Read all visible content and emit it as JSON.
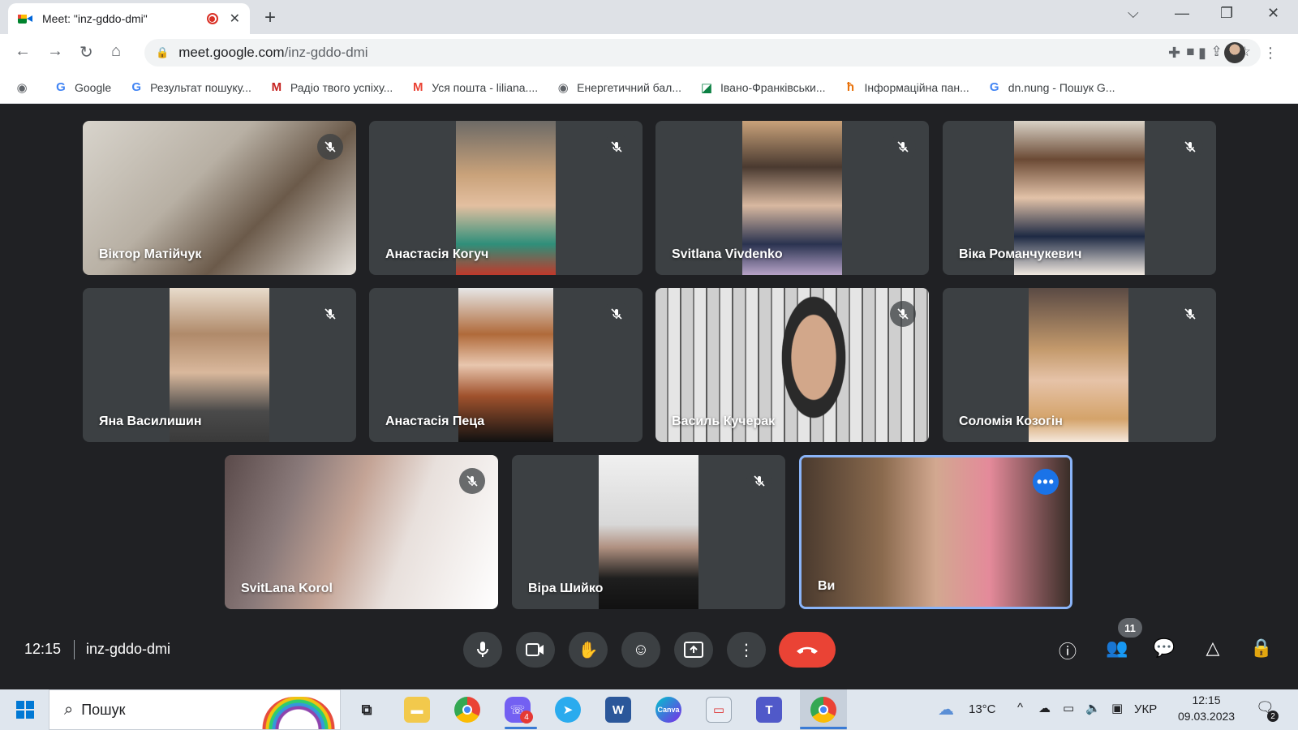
{
  "browser": {
    "tab_title": "Meet: \"inz-gddo-dmi\"",
    "url_host": "meet.google.com",
    "url_path": "/inz-gddo-dmi",
    "bookmarks": [
      {
        "label": "Google",
        "icon": "google-icon",
        "color": "#4285f4"
      },
      {
        "label": "Результат пошуку...",
        "icon": "google-icon",
        "color": "#4285f4"
      },
      {
        "label": "Радіо твого успіху...",
        "icon": "radio-logo-icon",
        "color": "#c5221f"
      },
      {
        "label": "Уся пошта - liliana....",
        "icon": "gmail-icon",
        "color": "#ea4335"
      },
      {
        "label": "Енергетичний бал...",
        "icon": "globe-icon",
        "color": "#5f6368"
      },
      {
        "label": "Івано-Франківськи...",
        "icon": "site-icon",
        "color": "#0b8043"
      },
      {
        "label": "Інформаційна пан...",
        "icon": "site-icon",
        "color": "#e8710a"
      },
      {
        "label": "dn.nung - Пошук G...",
        "icon": "google-icon",
        "color": "#4285f4"
      }
    ]
  },
  "participants": [
    {
      "name": "Віктор Матійчук",
      "muted": true
    },
    {
      "name": "Анастасія Когуч",
      "muted": true
    },
    {
      "name": "Svitlana Vivdenko",
      "muted": true
    },
    {
      "name": "Віка Романчукевич",
      "muted": true
    },
    {
      "name": "Яна Василишин",
      "muted": true
    },
    {
      "name": "Анастасія Пеца",
      "muted": true
    },
    {
      "name": "Василь Кучерак",
      "muted": true
    },
    {
      "name": "Соломія Козогін",
      "muted": true
    },
    {
      "name": "SvitLana Korol",
      "muted": true
    },
    {
      "name": "Віра Шийко",
      "muted": true
    },
    {
      "name": "Ви",
      "muted": false
    }
  ],
  "meeting": {
    "time": "12:15",
    "code": "inz-gddo-dmi",
    "participant_count": "11"
  },
  "taskbar": {
    "search_placeholder": "Пошук",
    "weather": "13°C",
    "language": "УКР",
    "clock_time": "12:15",
    "clock_date": "09.03.2023",
    "notification_count": "2",
    "viber_badge": "4"
  },
  "colors": {
    "meet_bg": "#202124",
    "tile_bg": "#3c4043",
    "end_call": "#ea4335",
    "active_speaker": "#8ab4f8"
  }
}
